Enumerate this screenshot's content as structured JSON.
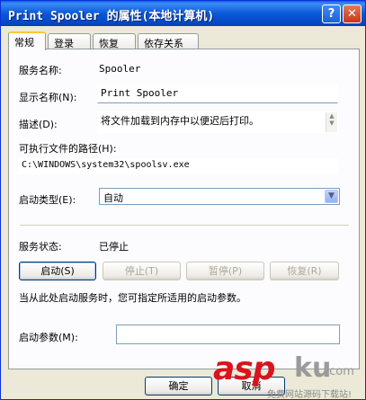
{
  "window": {
    "title": "Print Spooler 的属性(本地计算机)",
    "help_button": "?",
    "close_button": "✕"
  },
  "tabs": [
    {
      "label": "常规",
      "active": true
    },
    {
      "label": "登录",
      "active": false
    },
    {
      "label": "恢复",
      "active": false
    },
    {
      "label": "依存关系",
      "active": false
    }
  ],
  "general": {
    "service_name_label": "服务名称:",
    "service_name_value": "Spooler",
    "display_name_label": "显示名称(N):",
    "display_name_value": "Print Spooler",
    "description_label": "描述(D):",
    "description_value": "将文件加载到内存中以便迟后打印。",
    "exe_path_label": "可执行文件的路径(H):",
    "exe_path_value": "C:\\WINDOWS\\system32\\spoolsv.exe",
    "startup_type_label": "启动类型(E):",
    "startup_type_value": "自动",
    "service_status_label": "服务状态:",
    "service_status_value": "已停止",
    "start_button": "启动(S)",
    "stop_button": "停止(T)",
    "pause_button": "暂停(P)",
    "resume_button": "恢复(R)",
    "hint_text": "当从此处启动服务时，您可指定所适用的启动参数。",
    "start_params_label": "启动参数(M):",
    "start_params_value": ""
  },
  "footer": {
    "ok_button": "确定",
    "cancel_button": "取消"
  },
  "watermark": {
    "brand_a": "asp",
    "brand_b": "ku",
    "brand_c": ".com",
    "tagline": "免费网站源码下载站!"
  },
  "colors": {
    "titlebar": "#0a58d8",
    "tab_highlight": "#ffc83c",
    "watermark_red": "#d9141c"
  }
}
